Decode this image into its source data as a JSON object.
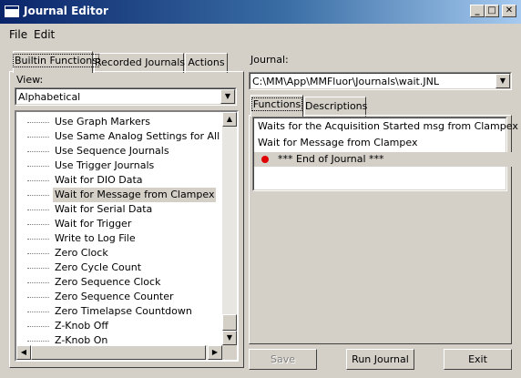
{
  "window": {
    "title": "Journal Editor",
    "minimize": "_",
    "maximize": "□",
    "close": "✕"
  },
  "menu": {
    "file": "File",
    "edit": "Edit"
  },
  "left_tabs": [
    "Builtin Functions",
    "Recorded Journals",
    "Actions"
  ],
  "view": {
    "label": "View:",
    "value": "Alphabetical"
  },
  "functions": [
    "Use Graph Markers",
    "Use Same Analog Settings for All Waves",
    "Use Sequence Journals",
    "Use Trigger Journals",
    "Wait for DIO Data",
    "Wait for Message from Clampex",
    "Wait for Serial Data",
    "Wait for Trigger",
    "Write to Log File",
    "Zero Clock",
    "Zero Cycle Count",
    "Zero Sequence Clock",
    "Zero Sequence Counter",
    "Zero Timelapse Countdown",
    "Z-Knob Off",
    "Z-Knob On"
  ],
  "selected_function": "Wait for Message from Clampex",
  "journal": {
    "label": "Journal:",
    "path": "C:\\MM\\App\\MMFluor\\Journals\\wait.JNL"
  },
  "right_tabs": [
    "Functions",
    "Descriptions"
  ],
  "journal_items": [
    "Waits for the Acquisition Started msg from Clampex",
    "Wait for Message from Clampex",
    "*** End of Journal ***"
  ],
  "end_marker_color": "#e00000",
  "buttons": {
    "save": "Save",
    "run": "Run Journal",
    "exit": "Exit"
  }
}
